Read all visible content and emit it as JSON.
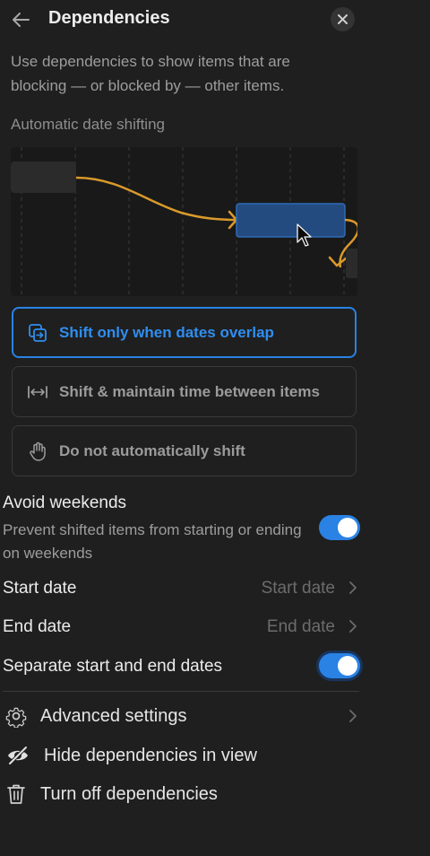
{
  "header": {
    "title": "Dependencies",
    "back_icon": "arrow-left-icon",
    "close_icon": "close-icon"
  },
  "description": "Use dependencies to show items that are blocking — or blocked by — other items.",
  "auto_shift": {
    "label": "Automatic date shifting",
    "options": [
      {
        "label": "Shift only when dates overlap",
        "icon": "shift-overlap-icon",
        "selected": true
      },
      {
        "label": "Shift & maintain time between items",
        "icon": "shift-maintain-icon",
        "selected": false
      },
      {
        "label": "Do not automatically shift",
        "icon": "hand-icon",
        "selected": false
      }
    ]
  },
  "avoid_weekends": {
    "title": "Avoid weekends",
    "subtitle": "Prevent shifted items from starting or ending on weekends",
    "enabled": true
  },
  "start_date": {
    "label": "Start date",
    "value": "Start date"
  },
  "end_date": {
    "label": "End date",
    "value": "End date"
  },
  "separate_dates": {
    "label": "Separate start and end dates",
    "enabled": true
  },
  "menu": {
    "advanced": {
      "label": "Advanced settings",
      "icon": "gear-icon"
    },
    "hide": {
      "label": "Hide dependencies in view",
      "icon": "eye-slash-icon"
    },
    "turn_off": {
      "label": "Turn off dependencies",
      "icon": "trash-icon"
    }
  },
  "colors": {
    "accent": "#2a82e4",
    "dependency_line": "#d99a2b",
    "background": "#1f1f1f"
  }
}
